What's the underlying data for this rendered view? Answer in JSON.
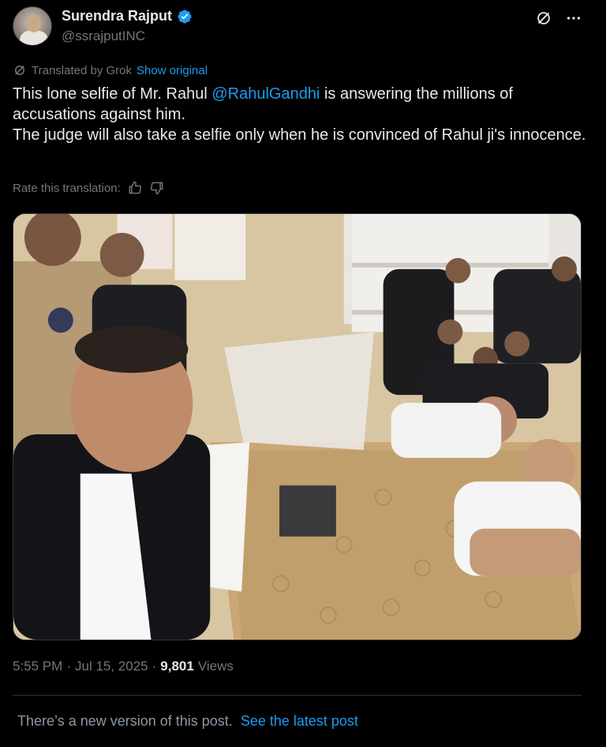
{
  "author": {
    "display_name": "Surendra Rajput",
    "handle": "@ssrajputINC",
    "verified": true,
    "verified_color": "#1d9bf0"
  },
  "header_icons": [
    "grok-icon",
    "more-icon"
  ],
  "translation": {
    "label": "Translated by Grok",
    "show_original": "Show original"
  },
  "tweet": {
    "line1_before": "This lone selfie of Mr. Rahul ",
    "line1_mention": "@RahulGandhi",
    "line1_after": " is answering the millions of accusations against him.",
    "line2": "The judge will also take a selfie only when he is convinced of Rahul ji's innocence."
  },
  "rate": {
    "label": "Rate this translation:",
    "icons": [
      "thumbs-up-icon",
      "thumbs-down-icon"
    ]
  },
  "meta": {
    "time": "5:55 PM",
    "sep1": "·",
    "date": "Jul 15, 2025",
    "sep2": "·",
    "views_count": "9,801",
    "views_label": "Views"
  },
  "new_version": {
    "message": "There’s a new version of this post.",
    "link": "See the latest post"
  },
  "colors": {
    "background": "#000000",
    "text": "#e7e9ea",
    "muted": "#71767b",
    "accent": "#1d9bf0",
    "border": "#2f3336"
  }
}
